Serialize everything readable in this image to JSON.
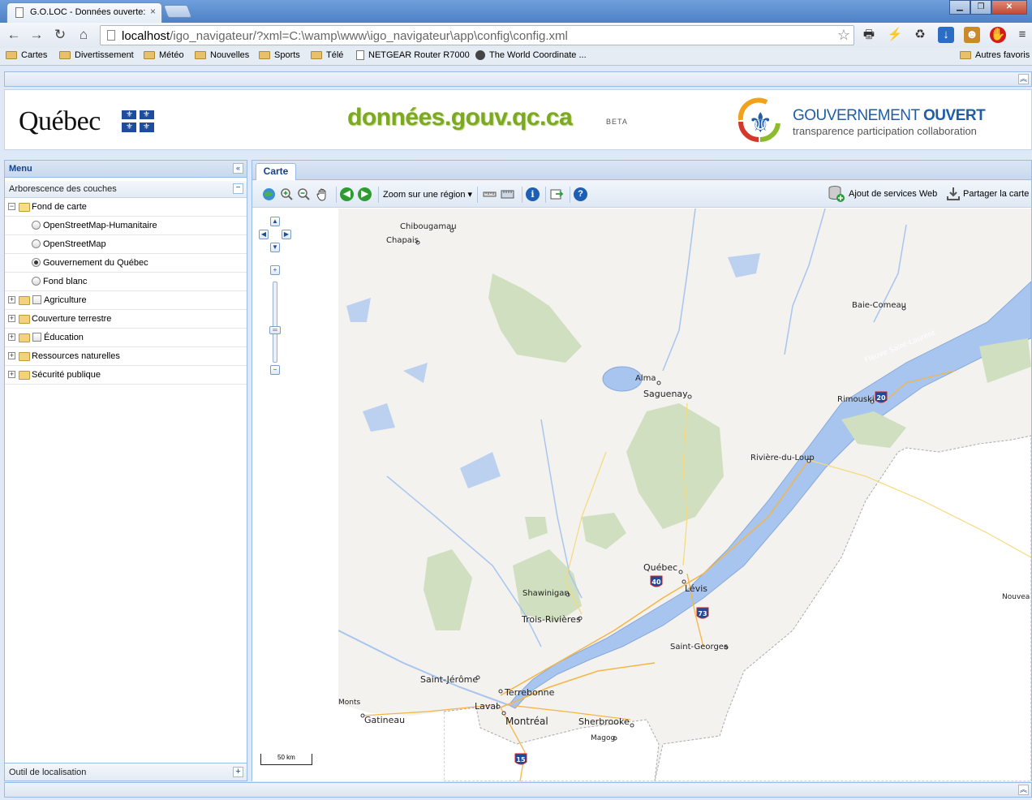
{
  "browser": {
    "tab_title": "G.O.LOC - Données ouverte:",
    "tab_close": "×",
    "url_host": "localhost",
    "url_path": "/igo_navigateur/?xml=C:\\wamp\\www\\igo_navigateur\\app\\config\\config.xml",
    "bookmarks": [
      {
        "label": "Cartes",
        "icon": "folder-icon"
      },
      {
        "label": "Divertissement",
        "icon": "folder-icon"
      },
      {
        "label": "Météo",
        "icon": "folder-icon"
      },
      {
        "label": "Nouvelles",
        "icon": "folder-icon"
      },
      {
        "label": "Sports",
        "icon": "folder-icon"
      },
      {
        "label": "Télé",
        "icon": "folder-icon"
      },
      {
        "label": "NETGEAR Router R7000",
        "icon": "page-icon"
      },
      {
        "label": "The World Coordinate ...",
        "icon": "globe-icon"
      }
    ],
    "other_bookmarks": "Autres favoris"
  },
  "banner": {
    "quebec": "Québec",
    "donnees": "données.gouv.qc.ca",
    "beta": "BETA",
    "gov_title_light": "GOUVERNEMENT ",
    "gov_title_bold": "OUVERT",
    "gov_sub": "transparence  participation  collaboration"
  },
  "menu": {
    "title": "Menu",
    "tree_title": "Arborescence des couches",
    "fond_de_carte": "Fond de carte",
    "basemaps": [
      {
        "label": "OpenStreetMap-Humanitaire",
        "selected": false
      },
      {
        "label": "OpenStreetMap",
        "selected": false
      },
      {
        "label": "Gouvernement du Québec",
        "selected": true
      },
      {
        "label": "Fond blanc",
        "selected": false
      }
    ],
    "layers": [
      {
        "label": "Agriculture",
        "checkbox": true
      },
      {
        "label": "Couverture terrestre",
        "checkbox": false
      },
      {
        "label": "Éducation",
        "checkbox": true
      },
      {
        "label": "Ressources naturelles",
        "checkbox": false
      },
      {
        "label": "Sécurité publique",
        "checkbox": false
      }
    ],
    "outil": "Outil de localisation"
  },
  "map_panel": {
    "tab": "Carte",
    "zoom_region": "Zoom sur une région",
    "add_web_services": "Ajout de services Web",
    "share_map": "Partager la carte",
    "scale": "50 km"
  },
  "map_labels": {
    "chibougamau": "Chibougamau",
    "chapais": "Chapais",
    "baie_comeau": "Baie-Comeau",
    "fleuve": "Fleuve Saint-Laurent",
    "alma": "Alma",
    "saguenay": "Saguenay",
    "rimouski": "Rimouski",
    "riviere_du_loup": "Rivière-du-Loup",
    "quebec": "Québec",
    "levis": "Lévis",
    "shawinigan": "Shawinigan",
    "trois_rivieres": "Trois-Rivières",
    "saint_georges": "Saint-Georges",
    "saint_jerome": "Saint-Jérôme",
    "terrebonne": "Terrebonne",
    "laval": "Laval",
    "montreal": "Montréal",
    "sherbrooke": "Sherbrooke",
    "magog": "Magog",
    "gatineau": "Gatineau",
    "monts": "Monts",
    "nouveau": "Nouvea",
    "hwy_20": "20",
    "hwy_40": "40",
    "hwy_73": "73",
    "hwy_15": "15"
  }
}
